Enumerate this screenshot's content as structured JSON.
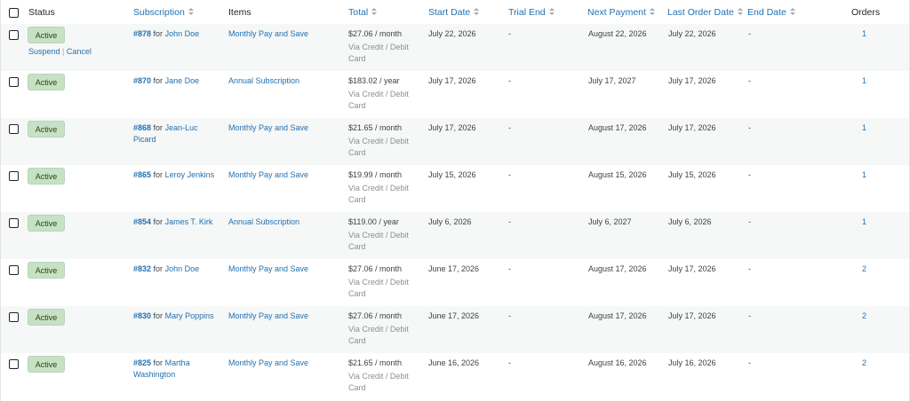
{
  "columns": {
    "status": "Status",
    "subscription": "Subscription",
    "items": "Items",
    "total": "Total",
    "start_date": "Start Date",
    "trial_end": "Trial End",
    "next_payment": "Next Payment",
    "last_order_date": "Last Order Date",
    "end_date": "End Date",
    "orders": "Orders"
  },
  "row_actions": {
    "suspend": "Suspend",
    "separator": "|",
    "cancel": "Cancel"
  },
  "rows": [
    {
      "status": "Active",
      "number": "#878",
      "for": "for",
      "customer": "John Doe",
      "item": "Monthly Pay and Save",
      "amount": "$27.06 / month",
      "method": "Via Credit / Debit Card",
      "start": "July 22, 2026",
      "trial_end": "-",
      "next_payment": "August 22, 2026",
      "last_order": "July 22, 2026",
      "end_date": "-",
      "orders": "1"
    },
    {
      "status": "Active",
      "number": "#870",
      "for": "for",
      "customer": "Jane Doe",
      "item": "Annual Subscription",
      "amount": "$183.02 / year",
      "method": "Via Credit / Debit Card",
      "start": "July 17, 2026",
      "trial_end": "-",
      "next_payment": "July 17, 2027",
      "last_order": "July 17, 2026",
      "end_date": "-",
      "orders": "1"
    },
    {
      "status": "Active",
      "number": "#868",
      "for": "for",
      "customer": "Jean-Luc Picard",
      "item": "Monthly Pay and Save",
      "amount": "$21.65 / month",
      "method": "Via Credit / Debit Card",
      "start": "July 17, 2026",
      "trial_end": "-",
      "next_payment": "August 17, 2026",
      "last_order": "July 17, 2026",
      "end_date": "-",
      "orders": "1"
    },
    {
      "status": "Active",
      "number": "#865",
      "for": "for",
      "customer": "Leroy Jenkins",
      "item": "Monthly Pay and Save",
      "amount": "$19.99 / month",
      "method": "Via Credit / Debit Card",
      "start": "July 15, 2026",
      "trial_end": "-",
      "next_payment": "August 15, 2026",
      "last_order": "July 15, 2026",
      "end_date": "-",
      "orders": "1"
    },
    {
      "status": "Active",
      "number": "#854",
      "for": "for",
      "customer": "James T. Kirk",
      "item": "Annual Subscription",
      "amount": "$119.00 / year",
      "method": "Via Credit / Debit Card",
      "start": "July 6, 2026",
      "trial_end": "-",
      "next_payment": "July 6, 2027",
      "last_order": "July 6, 2026",
      "end_date": "-",
      "orders": "1"
    },
    {
      "status": "Active",
      "number": "#832",
      "for": "for",
      "customer": "John Doe",
      "item": "Monthly Pay and Save",
      "amount": "$27.06 / month",
      "method": "Via Credit / Debit Card",
      "start": "June 17, 2026",
      "trial_end": "-",
      "next_payment": "August 17, 2026",
      "last_order": "July 17, 2026",
      "end_date": "-",
      "orders": "2"
    },
    {
      "status": "Active",
      "number": "#830",
      "for": "for",
      "customer": "Mary Poppins",
      "item": "Monthly Pay and Save",
      "amount": "$27.06 / month",
      "method": "Via Credit / Debit Card",
      "start": "June 17, 2026",
      "trial_end": "-",
      "next_payment": "August 17, 2026",
      "last_order": "July 17, 2026",
      "end_date": "-",
      "orders": "2"
    },
    {
      "status": "Active",
      "number": "#825",
      "for": "for",
      "customer": "Martha Washington",
      "item": "Monthly Pay and Save",
      "amount": "$21.65 / month",
      "method": "Via Credit / Debit Card",
      "start": "June 16, 2026",
      "trial_end": "-",
      "next_payment": "August 16, 2026",
      "last_order": "July 16, 2026",
      "end_date": "-",
      "orders": "2"
    }
  ]
}
